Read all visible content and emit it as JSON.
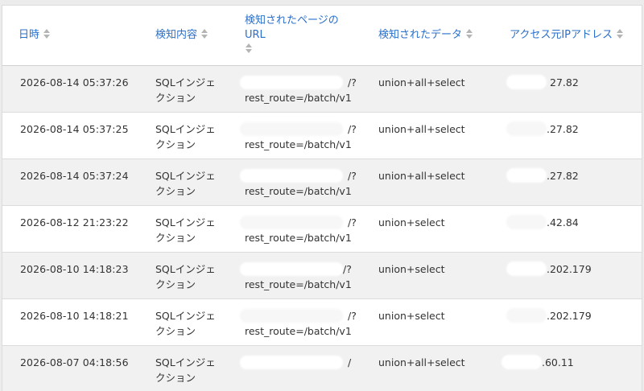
{
  "table": {
    "headers": [
      {
        "label": "日時"
      },
      {
        "label": "検知内容"
      },
      {
        "label_line1": "検知されたページの",
        "label_line2": "URL"
      },
      {
        "label": "検知されたデータ"
      },
      {
        "label": "アクセス元IPアドレス"
      }
    ],
    "rows": [
      {
        "date": "2026-08-14 05:37:26",
        "type_line1": "SQLインジェ",
        "type_line2": "クション",
        "url_tail": "/?",
        "url_route": "rest_route=/batch/v1",
        "data": "union+all+select",
        "ip": "27.82"
      },
      {
        "date": "2026-08-14 05:37:25",
        "type_line1": "SQLインジェ",
        "type_line2": "クション",
        "url_tail": "/?",
        "url_route": "rest_route=/batch/v1",
        "data": "union+all+select",
        "ip": ".27.82"
      },
      {
        "date": "2026-08-14 05:37:24",
        "type_line1": "SQLインジェ",
        "type_line2": "クション",
        "url_tail": "/?",
        "url_route": "rest_route=/batch/v1",
        "data": "union+all+select",
        "ip": ".27.82"
      },
      {
        "date": "2026-08-12 21:23:22",
        "type_line1": "SQLインジェ",
        "type_line2": "クション",
        "url_tail": "/?",
        "url_route": "rest_route=/batch/v1",
        "data": "union+select",
        "ip": ".42.84"
      },
      {
        "date": "2026-08-10 14:18:23",
        "type_line1": "SQLインジェ",
        "type_line2": "クション",
        "url_tail": "/?",
        "url_route": "rest_route=/batch/v1",
        "data": "union+select",
        "ip": ".202.179"
      },
      {
        "date": "2026-08-10 14:18:21",
        "type_line1": "SQLインジェ",
        "type_line2": "クション",
        "url_tail": "/?",
        "url_route": "rest_route=/batch/v1",
        "data": "union+select",
        "ip": ".202.179"
      },
      {
        "date": "2026-08-07 04:18:56",
        "type_line1": "SQLインジェ",
        "type_line2": "クション",
        "url_tail": "/",
        "url_route": "",
        "data": "union+all+select",
        "ip": ".60.11"
      }
    ]
  },
  "colors": {
    "header_text": "#2a6fc9",
    "sort_icon": "#b5b5b5",
    "row_alt": "#f1f1f1"
  }
}
